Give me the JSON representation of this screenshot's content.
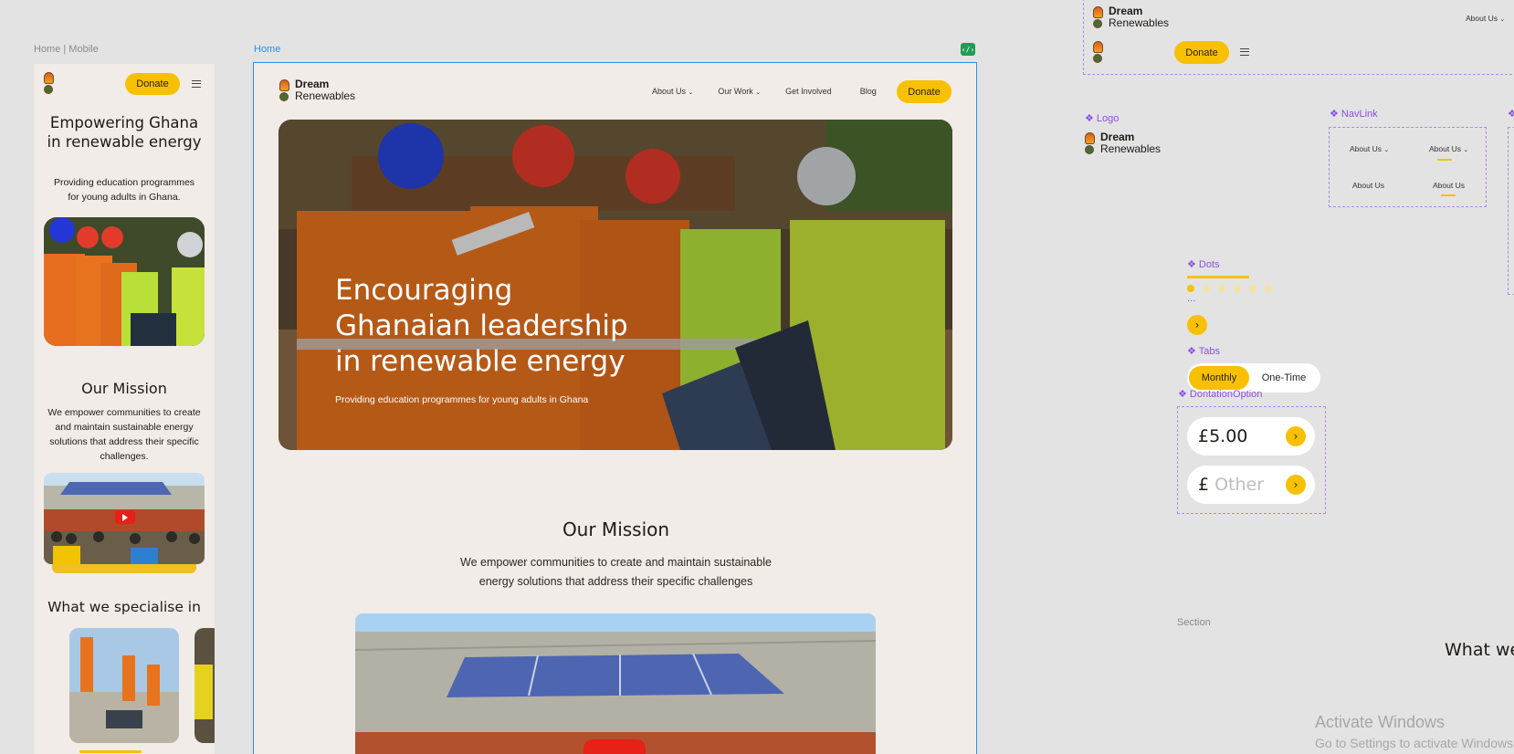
{
  "mobile": {
    "frame_label": "Home | Mobile",
    "donate_label": "Donate",
    "hero_title": "Empowering Ghana in renewable energy",
    "hero_subtitle": "Providing education programmes for young adults in Ghana.",
    "mission_title": "Our Mission",
    "mission_text": "We empower communities to create and maintain sustainable energy solutions that address their specific challenges.",
    "specialise_title": "What we specialise in"
  },
  "desktop": {
    "frame_label": "Home",
    "logo": {
      "line1": "Dream",
      "line2": "Renewables"
    },
    "nav": [
      {
        "label": "About Us",
        "has_dropdown": true
      },
      {
        "label": "Our Work",
        "has_dropdown": true
      },
      {
        "label": "Get Involved",
        "has_dropdown": false
      },
      {
        "label": "Blog",
        "has_dropdown": false
      }
    ],
    "donate_label": "Donate",
    "hero_title_lines": [
      "Encouraging",
      "Ghanaian leadership",
      "in renewable energy"
    ],
    "hero_subtitle": "Providing education programmes for young adults in Ghana",
    "mission_title": "Our Mission",
    "mission_text_lines": [
      "We empower communities to create and maintain sustainable",
      "energy solutions that address their specific challenges"
    ]
  },
  "components": {
    "header_preview": {
      "logo_line1": "Dream",
      "logo_line2": "Renewables",
      "nav_label": "About Us",
      "donate_label": "Donate"
    },
    "logo": {
      "label": "Logo",
      "line1": "Dream",
      "line2": "Renewables"
    },
    "navlink": {
      "label": "NavLink",
      "variants": [
        "About Us",
        "About Us",
        "About Us",
        "About Us"
      ]
    },
    "dots": {
      "label": "Dots",
      "ellipsis": "..."
    },
    "tabs": {
      "label": "Tabs",
      "active": "Monthly",
      "inactive": "One-Time"
    },
    "donation_option": {
      "label": "DontationOption",
      "amount": "£5.00",
      "currency": "£",
      "other_placeholder": "Other"
    },
    "section_label": "Section",
    "section_heading_partial": "What we"
  },
  "os_watermark": {
    "title": "Activate Windows",
    "subtitle": "Go to Settings to activate Windows."
  },
  "colors": {
    "accent": "#f7c000",
    "page_bg": "#f1ece7",
    "canvas": "#e3e3e3",
    "selection": "#2d8ee4",
    "component": "#8b4fe0"
  }
}
